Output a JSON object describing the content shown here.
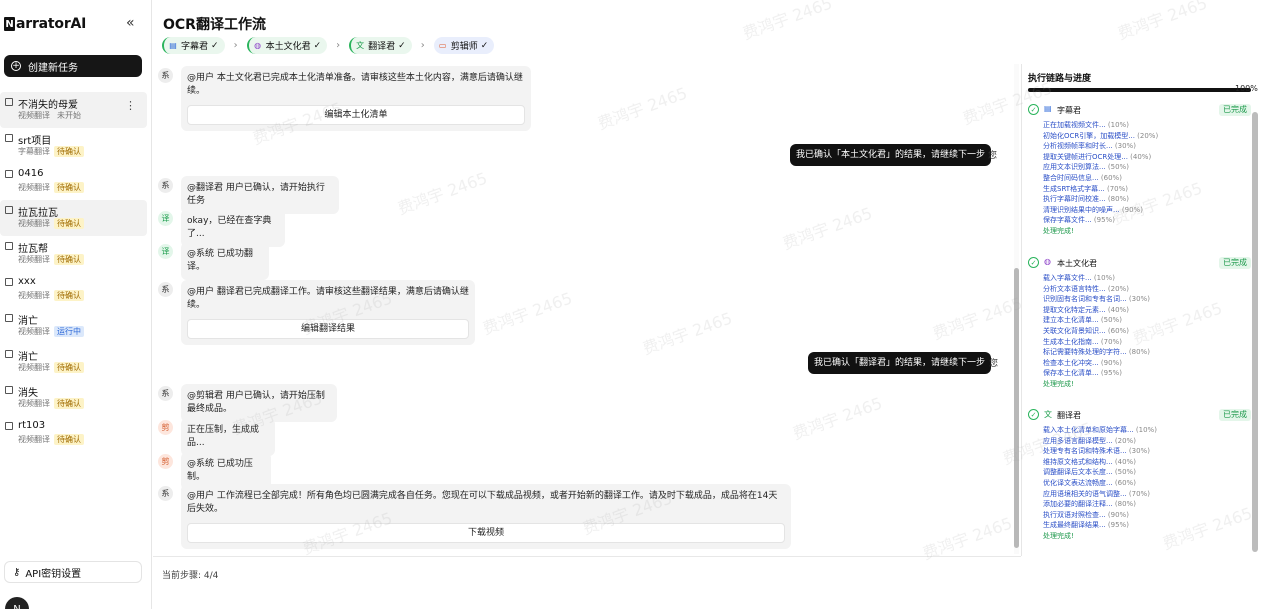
{
  "brand": {
    "logo_letter": "N",
    "name": "arratorAI",
    "collapse_icon": "«"
  },
  "sidebar": {
    "new_task_label": "创建新任务",
    "tasks": [
      {
        "name": "不消失的母爱",
        "type": "视频翻译",
        "status": "未开始",
        "status_kind": "none",
        "active": true
      },
      {
        "name": "srt项目",
        "type": "字幕翻译",
        "status": "待确认",
        "status_kind": "wait"
      },
      {
        "name": "0416",
        "type": "视频翻译",
        "status": "待确认",
        "status_kind": "wait"
      },
      {
        "name": "拉瓦拉瓦",
        "type": "视频翻译",
        "status": "待确认",
        "status_kind": "wait",
        "active": true
      },
      {
        "name": "拉瓦帮",
        "type": "视频翻译",
        "status": "待确认",
        "status_kind": "wait"
      },
      {
        "name": "xxx",
        "type": "视频翻译",
        "status": "待确认",
        "status_kind": "wait"
      },
      {
        "name": "消亡",
        "type": "视频翻译",
        "status": "运行中",
        "status_kind": "run"
      },
      {
        "name": "消亡",
        "type": "视频翻译",
        "status": "待确认",
        "status_kind": "wait"
      },
      {
        "name": "消失",
        "type": "视频翻译",
        "status": "待确认",
        "status_kind": "wait"
      },
      {
        "name": "rt103",
        "type": "视频翻译",
        "status": "待确认",
        "status_kind": "wait"
      }
    ],
    "api_label": "API密钥设置",
    "avatar_letter": "N"
  },
  "header": {
    "title": "OCR翻译工作流",
    "steps": [
      {
        "label": "字幕君",
        "icon": "document-icon",
        "state": "done"
      },
      {
        "label": "本土文化君",
        "icon": "globe-icon",
        "state": "done"
      },
      {
        "label": "翻译君",
        "icon": "translate-icon",
        "state": "done"
      },
      {
        "label": "剪辑师",
        "icon": "video-icon",
        "state": "active"
      }
    ]
  },
  "chat": {
    "messages": [
      {
        "avatar": "系",
        "kind": "sys",
        "text": "@用户 本土文化君已完成本土化清单准备。请审核这些本土化内容，满意后请确认继续。",
        "button": "编辑本土化清单"
      },
      {
        "user": "我已确认「本土文化君」的结果，请继续下一步",
        "you": "您"
      },
      {
        "avatar": "系",
        "kind": "sys",
        "text": "@翻译君 用户已确认，请开始执行任务"
      },
      {
        "avatar": "译",
        "kind": "tr",
        "text": "okay，已经在查字典了..."
      },
      {
        "avatar": "译",
        "kind": "tr",
        "text": "@系统 已成功翻译。"
      },
      {
        "avatar": "系",
        "kind": "sys",
        "text": "@用户 翻译君已完成翻译工作。请审核这些翻译结果，满意后请确认继续。",
        "button": "编辑翻译结果"
      },
      {
        "user": "我已确认「翻译君」的结果，请继续下一步",
        "you": "您"
      },
      {
        "avatar": "系",
        "kind": "sys",
        "text": "@剪辑君 用户已确认，请开始压制最终成品。"
      },
      {
        "avatar": "剪",
        "kind": "ed",
        "text": "正在压制，生成成品..."
      },
      {
        "avatar": "剪",
        "kind": "ed",
        "text": "@系统 已成功压制。"
      },
      {
        "avatar": "系",
        "kind": "sys",
        "text": "@用户 工作流程已全部完成！所有角色均已圆满完成各自任务。您现在可以下载成品视频，或者开始新的翻译工作。请及时下载成品，成品将在14天后失效。",
        "button": "下载视频"
      }
    ],
    "current_step": "当前步骤: 4/4"
  },
  "panel": {
    "title": "执行链路与进度",
    "progress": 100,
    "progress_label": "100%",
    "agents": [
      {
        "name": "字幕君",
        "icon": "document-icon",
        "status": "已完成",
        "logs": [
          [
            "正在加载视频文件...",
            "(10%)"
          ],
          [
            "初始化OCR引擎，加载模型...",
            "(20%)"
          ],
          [
            "分析视频帧率和时长...",
            "(30%)"
          ],
          [
            "提取关键帧进行OCR处理...",
            "(40%)"
          ],
          [
            "应用文本识别算法...",
            "(50%)"
          ],
          [
            "整合时间码信息...",
            "(60%)"
          ],
          [
            "生成SRT格式字幕...",
            "(70%)"
          ],
          [
            "执行字幕时间校准...",
            "(80%)"
          ],
          [
            "清理识别结果中的噪声...",
            "(90%)"
          ],
          [
            "保存字幕文件...",
            "(95%)"
          ]
        ],
        "final": "处理完成!"
      },
      {
        "name": "本土文化君",
        "icon": "globe-icon",
        "status": "已完成",
        "logs": [
          [
            "载入字幕文件...",
            "(10%)"
          ],
          [
            "分析文本语言特性...",
            "(20%)"
          ],
          [
            "识别固有名词和专有名词...",
            "(30%)"
          ],
          [
            "提取文化特定元素...",
            "(40%)"
          ],
          [
            "建立本土化清单...",
            "(50%)"
          ],
          [
            "关联文化背景知识...",
            "(60%)"
          ],
          [
            "生成本土化指南...",
            "(70%)"
          ],
          [
            "标记需要特殊处理的字符...",
            "(80%)"
          ],
          [
            "检查本土化冲突...",
            "(90%)"
          ],
          [
            "保存本土化清单...",
            "(95%)"
          ]
        ],
        "final": "处理完成!"
      },
      {
        "name": "翻译君",
        "icon": "translate-icon",
        "status": "已完成",
        "logs": [
          [
            "载入本土化清单和原始字幕...",
            "(10%)"
          ],
          [
            "应用多语言翻译模型...",
            "(20%)"
          ],
          [
            "处理专有名词和特殊术语...",
            "(30%)"
          ],
          [
            "维持原文格式和结构...",
            "(40%)"
          ],
          [
            "调整翻译后文本长度...",
            "(50%)"
          ],
          [
            "优化译文表达流畅度...",
            "(60%)"
          ],
          [
            "应用语境相关的语气调整...",
            "(70%)"
          ],
          [
            "添加必要的翻译注释...",
            "(80%)"
          ],
          [
            "执行双语对照检查...",
            "(90%)"
          ],
          [
            "生成最终翻译结果...",
            "(95%)"
          ]
        ],
        "final": "处理完成!"
      }
    ]
  },
  "watermark_text": "费鸿宇 2465"
}
